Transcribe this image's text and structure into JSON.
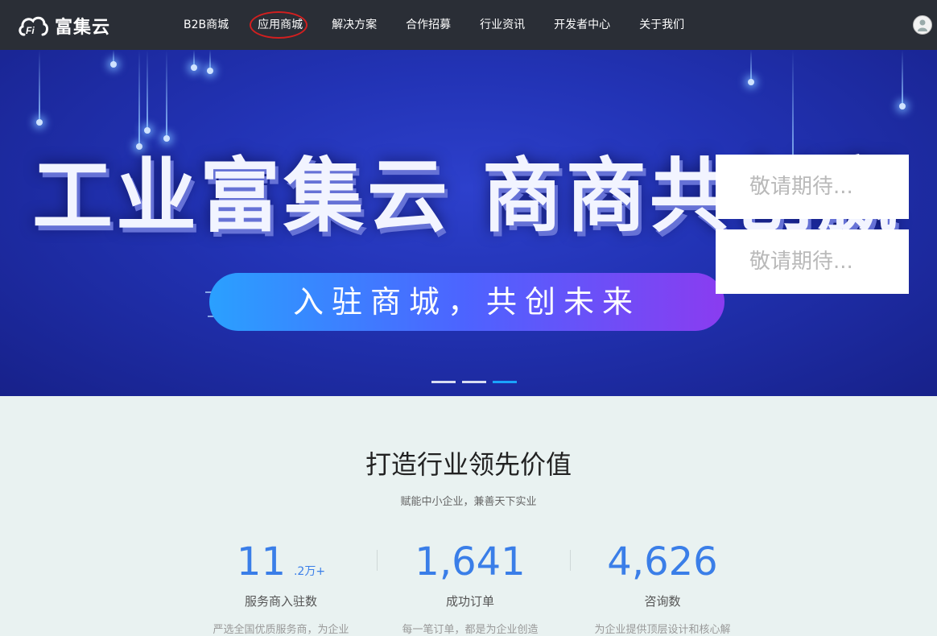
{
  "nav": {
    "logo_text": "富集云",
    "items": [
      {
        "label": "B2B商城"
      },
      {
        "label": "应用商城"
      },
      {
        "label": "解决方案"
      },
      {
        "label": "合作招募"
      },
      {
        "label": "行业资讯"
      },
      {
        "label": "开发者中心"
      },
      {
        "label": "关于我们"
      }
    ]
  },
  "banner": {
    "headline": "工业富集云  商商共创赢",
    "slogan": "入驻商城，共创未来",
    "popups": [
      "敬请期待...",
      "敬请期待..."
    ],
    "slides": {
      "count": 3,
      "active_index": 2
    }
  },
  "section": {
    "title": "打造行业领先价值",
    "subtitle": "赋能中小企业，兼善天下实业",
    "stats": [
      {
        "value": "11",
        "unit": ".2万+",
        "label": "服务商入驻数",
        "desc": "严选全国优质服务商，为企业"
      },
      {
        "value": "1,641",
        "unit": "",
        "label": "成功订单",
        "desc": "每一笔订单，都是为企业创造"
      },
      {
        "value": "4,626",
        "unit": "",
        "label": "咨询数",
        "desc": "为企业提供顶层设计和核心解"
      }
    ]
  },
  "colors": {
    "nav_bg": "#2a2e36",
    "accent_blue": "#3a7ee8",
    "banner_blue": "#2233b5",
    "active_dot": "#1aa3ff",
    "circle_red": "#d21f1f"
  }
}
